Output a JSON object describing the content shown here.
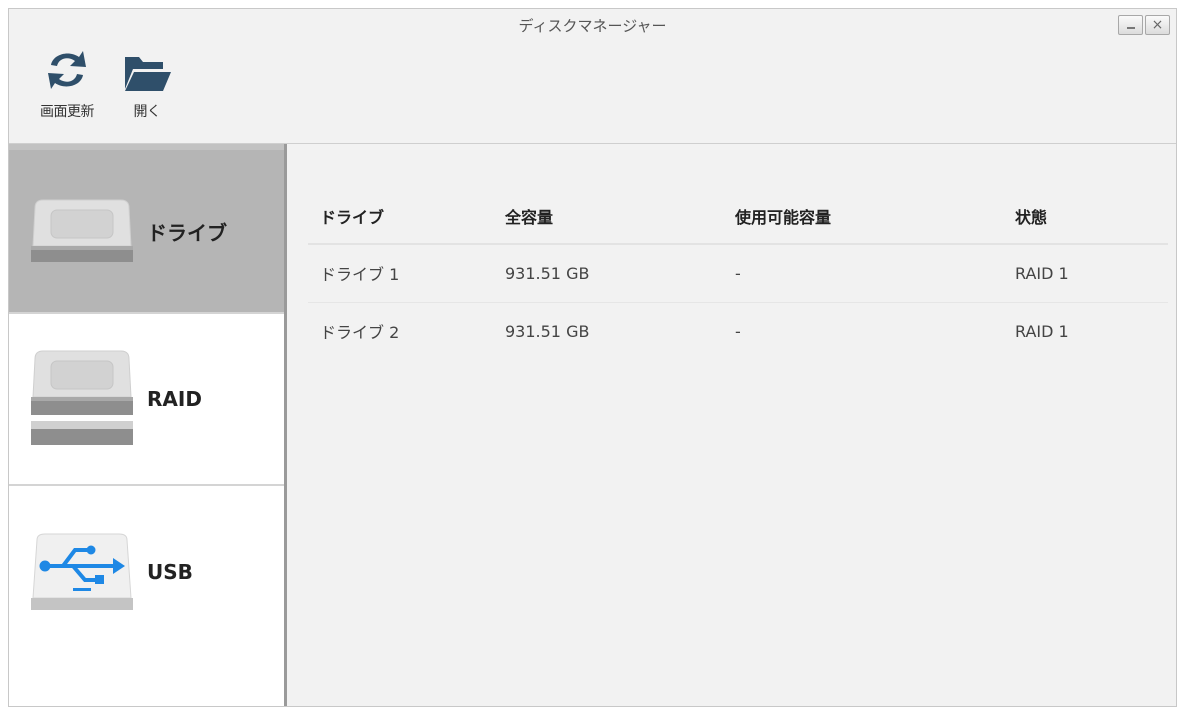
{
  "window": {
    "title": "ディスクマネージャー",
    "minimize_glyph": "_",
    "close_glyph": "×"
  },
  "toolbar": {
    "refresh_label": "画面更新",
    "open_label": "開く",
    "refresh_icon": "refresh-icon",
    "open_icon": "folder-icon",
    "icon_color": "#2f4f6a"
  },
  "sidebar": {
    "items": [
      {
        "label": "ドライブ",
        "icon": "hard-drive-icon",
        "active": true
      },
      {
        "label": "RAID",
        "icon": "raid-drives-icon",
        "active": false
      },
      {
        "label": "USB",
        "icon": "usb-drive-icon",
        "active": false
      }
    ],
    "active_bg": "#b5b5b5",
    "usb_accent": "#1e88e5"
  },
  "table": {
    "headers": [
      "ドライブ",
      "全容量",
      "使用可能容量",
      "状態"
    ],
    "rows": [
      [
        "ドライブ 1",
        "931.51 GB",
        "-",
        "RAID 1"
      ],
      [
        "ドライブ 2",
        "931.51 GB",
        "-",
        "RAID 1"
      ]
    ]
  }
}
